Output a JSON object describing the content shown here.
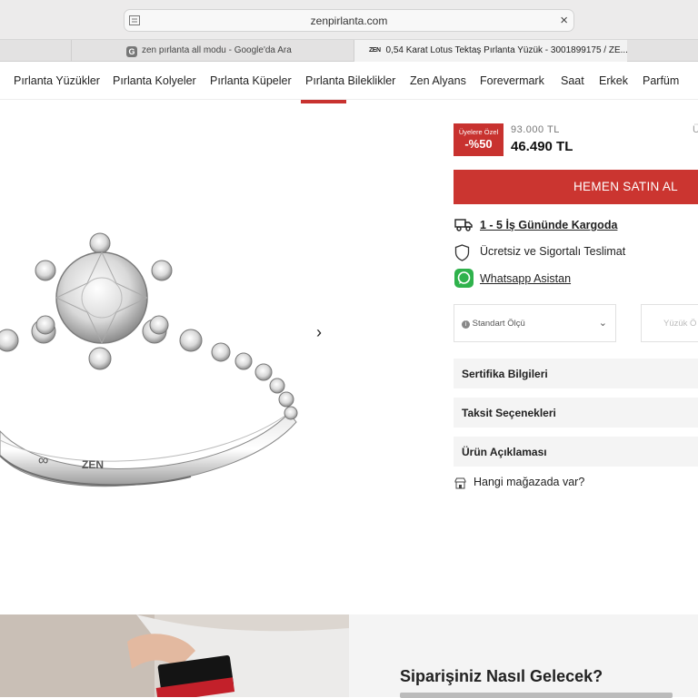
{
  "browser": {
    "url": "zenpirlanta.com",
    "tabs": [
      {
        "label": "zen pırlanta all modu - Google'da Ara",
        "icon": "G"
      },
      {
        "label": "0,54 Karat Lotus Tektaş Pırlanta Yüzük - 3001899175 / ZE...",
        "icon": "ZEN"
      }
    ]
  },
  "nav": {
    "items": [
      "Pırlanta Yüzükler",
      "Pırlanta Kolyeler",
      "Pırlanta Küpeler",
      "Pırlanta Bileklikler",
      "Zen Alyans",
      "Forevermark",
      "Saat",
      "Erkek",
      "Parfüm"
    ]
  },
  "product": {
    "badge_line1": "Üyelere Özel",
    "badge_line2": "-%50",
    "old_price": "93.000 TL",
    "new_price": "46.490 TL",
    "cut_label": "Ü",
    "buy_label": "HEMEN SATIN AL",
    "ring_brand": "ZEN"
  },
  "info": {
    "shipping": "1 - 5 İş Gününde Kargoda",
    "delivery": "Ücretsiz ve Sigortalı Teslimat",
    "whatsapp": "Whatsapp Asistan"
  },
  "size": {
    "select_label": "Standart Ölçü",
    "second_placeholder": "Yüzük Ö"
  },
  "accordion": {
    "items": [
      "Sertifika Bilgileri",
      "Taksit Seçenekleri",
      "Ürün Açıklaması"
    ]
  },
  "store": {
    "label": "Hangi mağazada var?"
  },
  "bottom": {
    "title": "Siparişiniz Nasıl Gelecek?"
  },
  "colors": {
    "accent": "#cb3530",
    "whatsapp": "#2fb24c"
  }
}
